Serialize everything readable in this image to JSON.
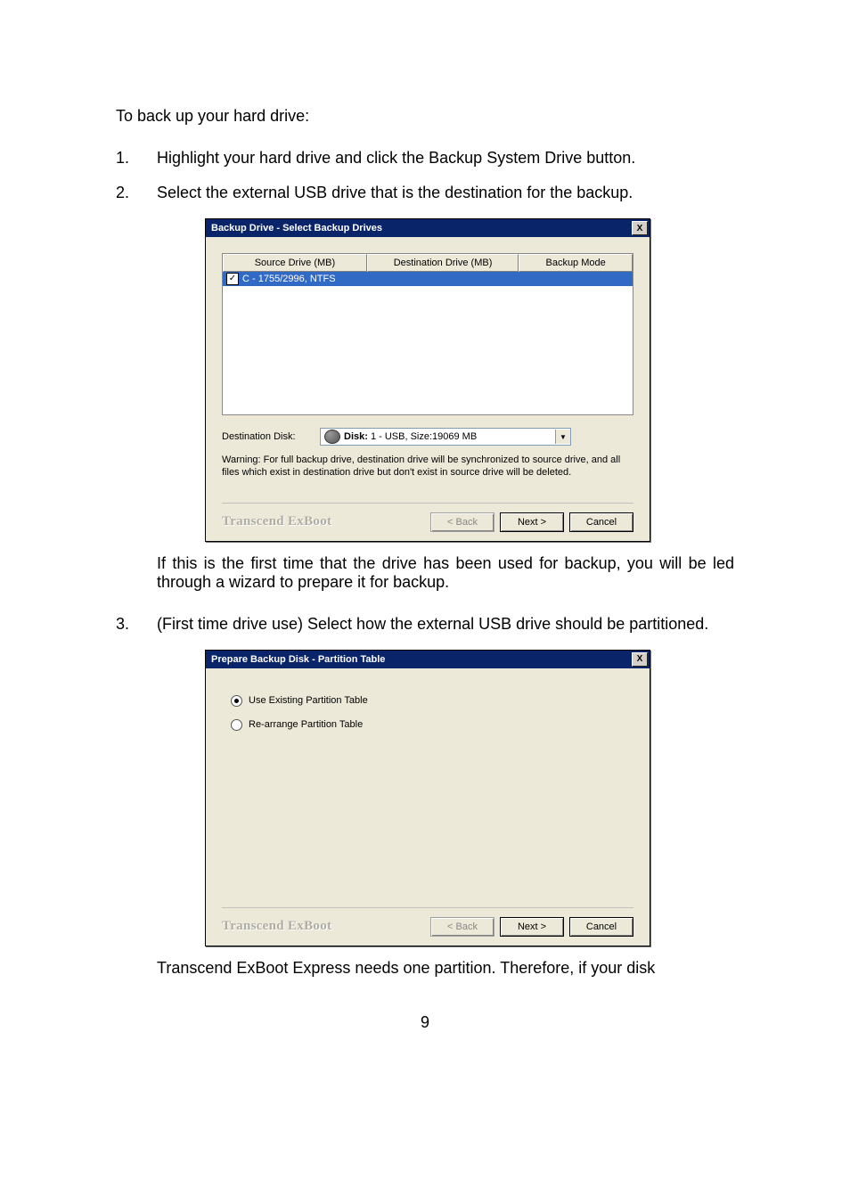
{
  "intro": "To back up your hard drive:",
  "steps": {
    "s1": {
      "num": "1.",
      "text": "Highlight your hard drive and click the Backup System Drive button."
    },
    "s2": {
      "num": "2.",
      "text": "Select the external USB drive that is the destination for the backup."
    },
    "s2_note": "If this is the first time that the drive has been used for backup, you will be led through a wizard to prepare it for backup.",
    "s3": {
      "num": "3.",
      "text": "(First time drive use) Select how the external USB drive should be partitioned."
    },
    "s3_note": "Transcend ExBoot Express needs one partition. Therefore, if your disk"
  },
  "dlg1": {
    "title": "Backup Drive - Select Backup Drives",
    "close": "X",
    "th1": "Source Drive (MB)",
    "th2": "Destination Drive (MB)",
    "th3": "Backup Mode",
    "row1": "C - 1755/2996, NTFS",
    "dest_label": "Destination Disk:",
    "dest_bold": "Disk:",
    "dest_text": " 1 - USB, Size:19069 MB",
    "dropdown_arrow": "▼",
    "warning": "Warning: For full backup drive, destination drive will be synchronized to source drive, and all files which exist in destination drive but don't exist in source drive will be deleted.",
    "brand": "Transcend ExBoot",
    "back": "< Back",
    "next": "Next >",
    "cancel": "Cancel"
  },
  "dlg2": {
    "title": "Prepare Backup Disk - Partition Table",
    "close": "X",
    "opt1": "Use Existing Partition Table",
    "opt2": "Re-arrange Partition Table",
    "brand": "Transcend ExBoot",
    "back": "< Back",
    "next": "Next >",
    "cancel": "Cancel"
  },
  "pagenum": "9"
}
